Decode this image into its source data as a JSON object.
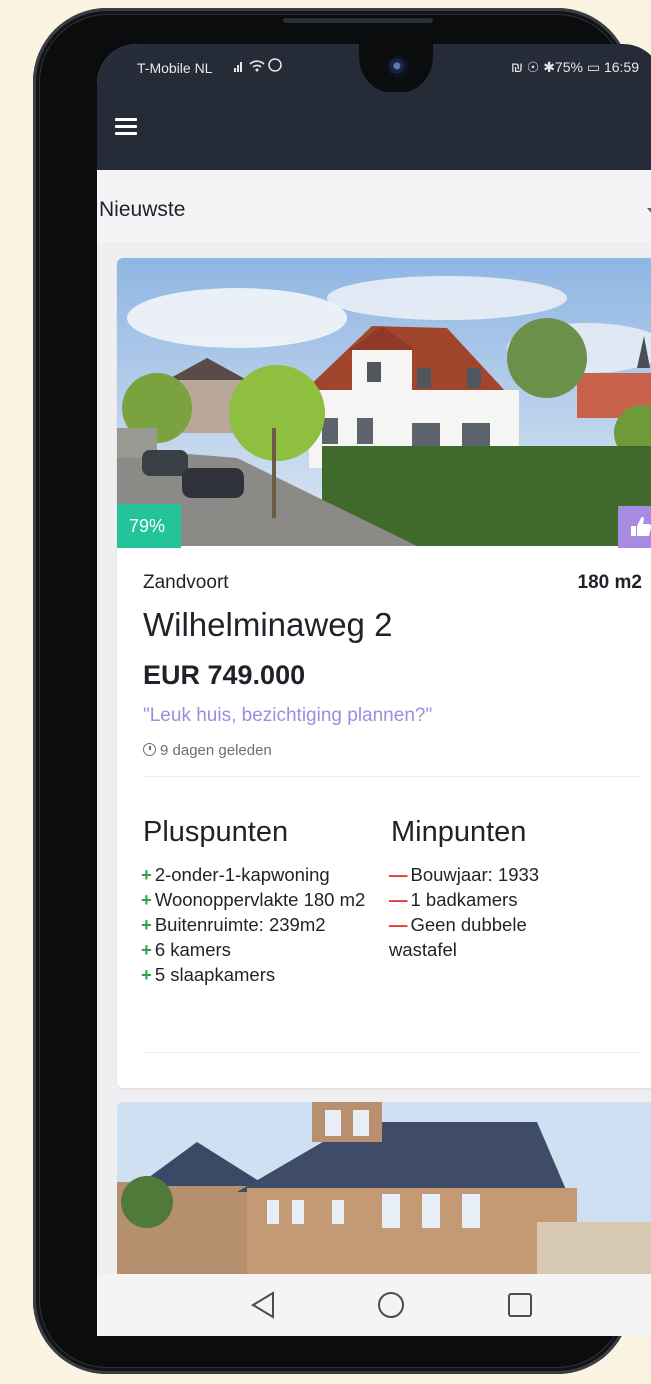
{
  "status_bar": {
    "carrier": "T-Mobile NL",
    "signal_icons": "signal-wifi-whatsapp-icons",
    "right_text": "₪ ☉ ✱75% ▭ 16:59"
  },
  "app_bar": {
    "menu_icon": "hamburger-icon"
  },
  "sort": {
    "selected": "Nieuwste"
  },
  "listing": {
    "score": "79%",
    "like_icon": "thumbs-up-icon",
    "city": "Zandvoort",
    "area": "180 m2",
    "street": "Wilhelminaweg 2",
    "price": "EUR 749.000",
    "note": "\"Leuk huis, bezichtiging plannen?\"",
    "time": "9 dagen geleden",
    "pros_title": "Pluspunten",
    "cons_title": "Minpunten",
    "pros": [
      "2-onder-1-kapwoning",
      "Woonoppervlakte 180 m2",
      "Buitenruimte: 239m2",
      "6 kamers",
      "5 slaapkamers"
    ],
    "cons": [
      "Bouwjaar: 1933",
      "1 badkamers",
      "Geen dubbele wastafel"
    ]
  },
  "colors": {
    "accent_green": "#23c49a",
    "accent_purple": "#a88be0",
    "appbar": "#262b38"
  },
  "nav": {
    "back_icon": "back-triangle-icon",
    "home_icon": "home-circle-icon",
    "recents_icon": "recents-square-icon"
  }
}
